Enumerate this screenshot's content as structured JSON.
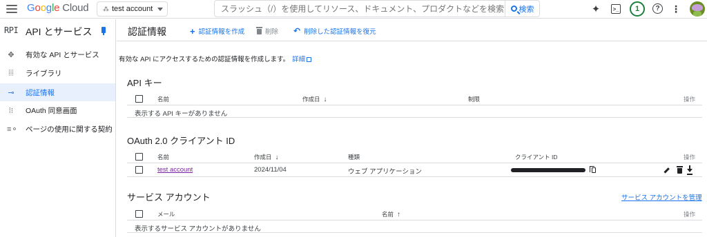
{
  "topbar": {
    "logo": {
      "letters": [
        "G",
        "o",
        "o",
        "g",
        "l",
        "e"
      ],
      "product": "Cloud"
    },
    "project_name": "test account",
    "search": {
      "placeholder": "スラッシュ（/）を使用してリソース、ドキュメント、プロダクトなどを検索",
      "button_label": "検索"
    },
    "notification_count": "1",
    "icons": [
      "menu-icon",
      "sparkle-icon",
      "terminal-icon",
      "help-icon",
      "more-vert-icon"
    ]
  },
  "sidebar": {
    "logo": "RPI",
    "title": "API とサービス",
    "items": [
      {
        "label": "有効な API とサービス",
        "icon": "api-icon",
        "active": false
      },
      {
        "label": "ライブラリ",
        "icon": "library-icon",
        "active": false
      },
      {
        "label": "認証情報",
        "icon": "key-icon",
        "active": true
      },
      {
        "label": "OAuth 同意画面",
        "icon": "consent-icon",
        "active": false
      },
      {
        "label": "ページの使用に関する契約",
        "icon": "settings-list-icon",
        "active": false
      }
    ]
  },
  "header": {
    "title": "認証情報",
    "actions": {
      "create": "認証情報を作成",
      "delete": "削除",
      "restore": "削除した認証情報を復元"
    }
  },
  "main": {
    "description": "有効な API にアクセスするための認証情報を作成します。",
    "learn_more": "詳細",
    "api_keys": {
      "title": "API キー",
      "columns": {
        "name": "名前",
        "created": "作成日",
        "restrictions": "制限",
        "actions": "操作"
      },
      "empty": "表示する API キーがありません"
    },
    "oauth": {
      "title": "OAuth 2.0 クライアント ID",
      "columns": {
        "name": "名前",
        "created": "作成日",
        "type": "種類",
        "client_id": "クライアント ID",
        "actions": "操作"
      },
      "rows": [
        {
          "name": "test account",
          "created": "2024/11/04",
          "type": "ウェブ アプリケーション"
        }
      ]
    },
    "service_accounts": {
      "title": "サービス アカウント",
      "manage": "サービス アカウントを管理",
      "columns": {
        "email": "メール",
        "name": "名前",
        "actions": "操作"
      },
      "empty": "表示するサービス アカウントがありません"
    }
  },
  "colors": {
    "accent": "#1a73e8",
    "active_bg": "#e8f0fe",
    "border": "#dadce0",
    "link_visited": "#7b1fa2"
  }
}
